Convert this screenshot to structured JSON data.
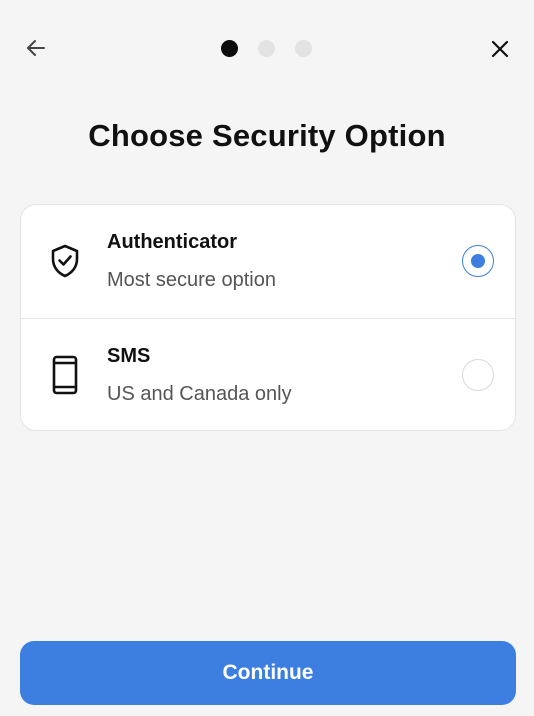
{
  "header": {
    "back_icon": "arrow-left-icon",
    "close_icon": "close-icon",
    "steps": [
      {
        "state": "active"
      },
      {
        "state": "inactive"
      },
      {
        "state": "inactive"
      }
    ]
  },
  "title": "Choose Security Option",
  "options": [
    {
      "icon": "shield-check-icon",
      "title": "Authenticator",
      "subtitle": "Most secure option",
      "selected": true
    },
    {
      "icon": "smartphone-icon",
      "title": "SMS",
      "subtitle": "US and Canada only",
      "selected": false
    }
  ],
  "continue_label": "Continue",
  "colors": {
    "accent": "#3d7fe0",
    "background": "#f5f5f5",
    "card": "#ffffff",
    "step_active": "#0d0d0d",
    "step_inactive": "#e3e3e3"
  }
}
